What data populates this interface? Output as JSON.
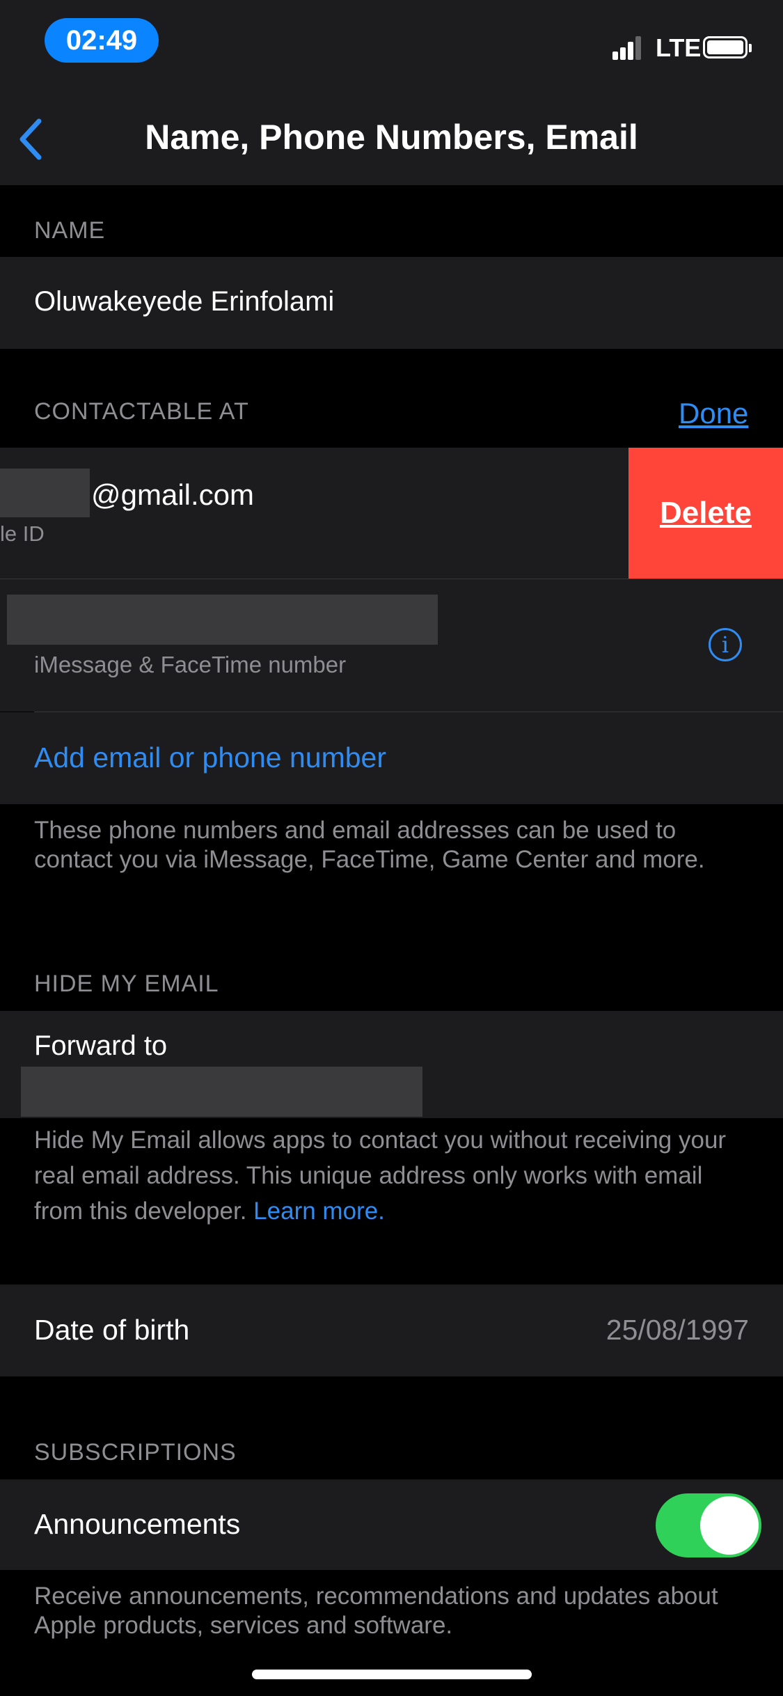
{
  "status_bar": {
    "time": "02:49",
    "network": "LTE"
  },
  "nav": {
    "title": "Name, Phone Numbers, Email",
    "back_icon": "chevron-left-icon"
  },
  "name_section": {
    "header": "NAME",
    "value": "Oluwakeyede Erinfolami"
  },
  "contactable": {
    "header": "CONTACTABLE AT",
    "done_label": "Done",
    "email_suffix": "@gmail.com",
    "email_sub": "le ID",
    "delete_label": "Delete",
    "phone_sub": "iMessage & FaceTime number",
    "add_label": "Add email or phone number",
    "footnote": "These phone numbers and email addresses can be used to contact you via iMessage, FaceTime, Game Center and more."
  },
  "hide_my_email": {
    "header": "HIDE MY EMAIL",
    "forward_label": "Forward to",
    "footnote_text": "Hide My Email allows apps to contact you without receiving your real email address. This unique address only works with email from this developer.",
    "learn_more": "Learn more."
  },
  "dob": {
    "label": "Date of birth",
    "value": "25/08/1997"
  },
  "subscriptions": {
    "header": "SUBSCRIPTIONS",
    "announcements_label": "Announcements",
    "toggle_on": true,
    "footnote": "Receive announcements, recommendations and updates about Apple products, services and software."
  },
  "colors": {
    "accent": "#2f8cf2",
    "delete": "#ff453a",
    "toggle": "#30d158",
    "cell_bg": "#1c1c1e"
  }
}
